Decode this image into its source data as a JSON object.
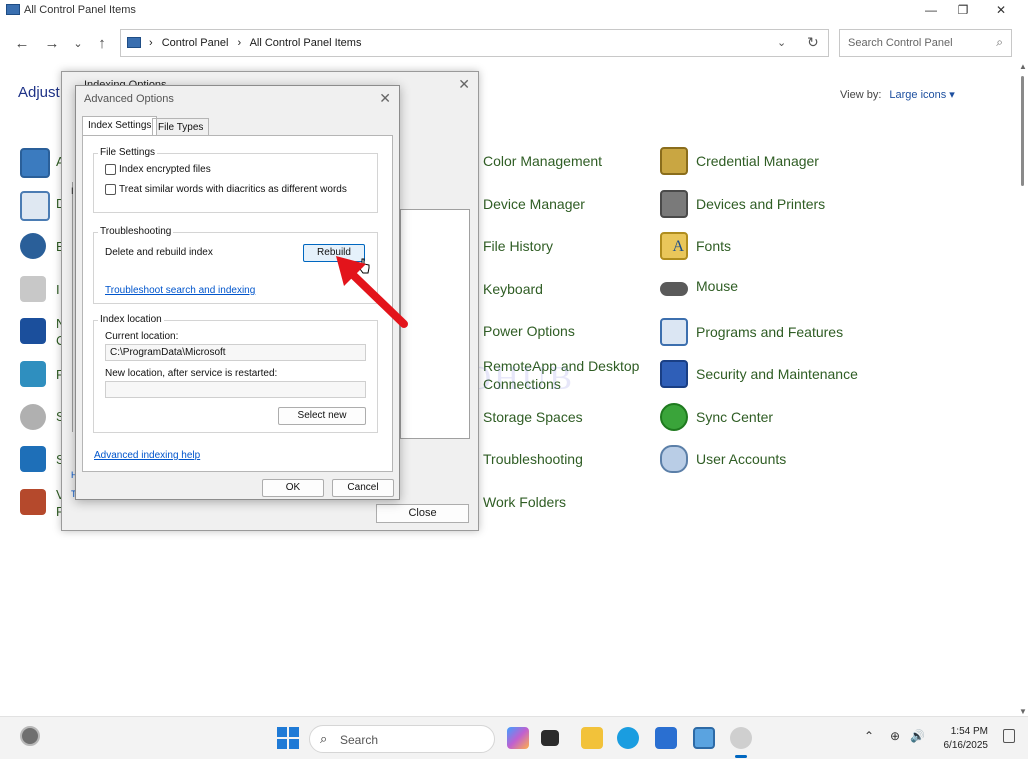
{
  "window": {
    "title": "All Control Panel Items",
    "minimize_glyph": "—",
    "maximize_glyph": "❐",
    "close_glyph": "✕"
  },
  "nav": {
    "back": "←",
    "forward": "→",
    "recent": "⌄",
    "up": "↑"
  },
  "address": {
    "crumbs": [
      "›",
      "Control Panel",
      "›",
      "All Control Panel Items"
    ],
    "dropdown_glyph": "⌄",
    "refresh_glyph": "↻"
  },
  "search": {
    "placeholder": "Search Control Panel",
    "icon": "search-icon"
  },
  "heading": "Adjust y",
  "viewby": {
    "label": "View by:",
    "value": "Large icons ▾"
  },
  "left_column_chars": [
    "A",
    "D",
    "E",
    "I",
    "N",
    "C",
    "F",
    "S",
    "S",
    "V",
    "F"
  ],
  "items_col1": [
    "Color Management",
    "Device Manager",
    "File History",
    "Keyboard",
    "Power Options",
    "RemoteApp and Desktop",
    "Connections",
    "Storage Spaces",
    "Troubleshooting",
    "Work Folders"
  ],
  "items_col2": [
    "Credential Manager",
    "Devices and Printers",
    "Fonts",
    "Mouse",
    "Programs and Features",
    "Security and Maintenance",
    "Sync Center",
    "User Accounts"
  ],
  "watermark": "IT PROHUB",
  "indexing_dialog": {
    "title": "Indexing Options",
    "close_glyph": "✕",
    "close_button": "Close",
    "left_chars": [
      "I",
      "H",
      "T"
    ]
  },
  "advanced_dialog": {
    "title": "Advanced Options",
    "close_glyph": "✕",
    "tabs": [
      "Index Settings",
      "File Types"
    ],
    "file_settings": {
      "label": "File Settings",
      "opt1": "Index encrypted files",
      "opt2": "Treat similar words with diacritics as different words"
    },
    "troubleshooting": {
      "label": "Troubleshooting",
      "delete_text": "Delete and rebuild index",
      "rebuild": "Rebuild",
      "link": "Troubleshoot search and indexing"
    },
    "index_location": {
      "label": "Index location",
      "current_label": "Current location:",
      "current_value": "C:\\ProgramData\\Microsoft",
      "new_label": "New location, after service is restarted:",
      "new_value": "",
      "select_new": "Select new"
    },
    "help_link": "Advanced indexing help",
    "ok": "OK",
    "cancel": "Cancel"
  },
  "taskbar": {
    "search": "Search",
    "time": "1:54 PM",
    "date": "6/16/2025",
    "tray_up": "⌃",
    "network": "⊕",
    "volume": "🔊"
  },
  "colors": {
    "link_green": "#2f5d24",
    "arrow_red": "#e3141b",
    "accent_blue": "#0067c0"
  }
}
